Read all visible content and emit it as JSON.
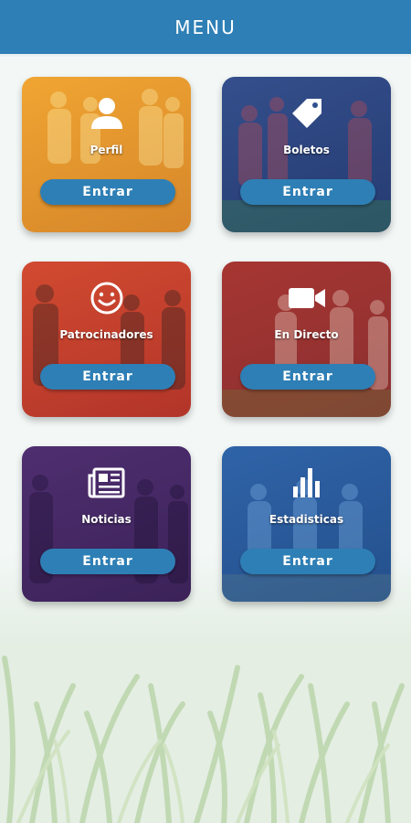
{
  "header": {
    "title": "MENU"
  },
  "cards": [
    {
      "label": "Perfil",
      "button": "Entrar",
      "icon": "user-icon",
      "color": "#e89a2c"
    },
    {
      "label": "Boletos",
      "button": "Entrar",
      "icon": "tag-icon",
      "color": "#2f4f8f"
    },
    {
      "label": "Patrocinadores",
      "button": "Entrar",
      "icon": "smiley-icon",
      "color": "#c8402c"
    },
    {
      "label": "En Directo",
      "button": "Entrar",
      "icon": "video-camera-icon",
      "color": "#b83a36"
    },
    {
      "label": "Noticias",
      "button": "Entrar",
      "icon": "newspaper-icon",
      "color": "#4a2d6b"
    },
    {
      "label": "Estadisticas",
      "button": "Entrar",
      "icon": "bar-chart-icon",
      "color": "#2d5da0"
    }
  ],
  "colors": {
    "header": "#2e7fb5",
    "button": "#2e7fb5",
    "background": "#f3f8f7"
  }
}
